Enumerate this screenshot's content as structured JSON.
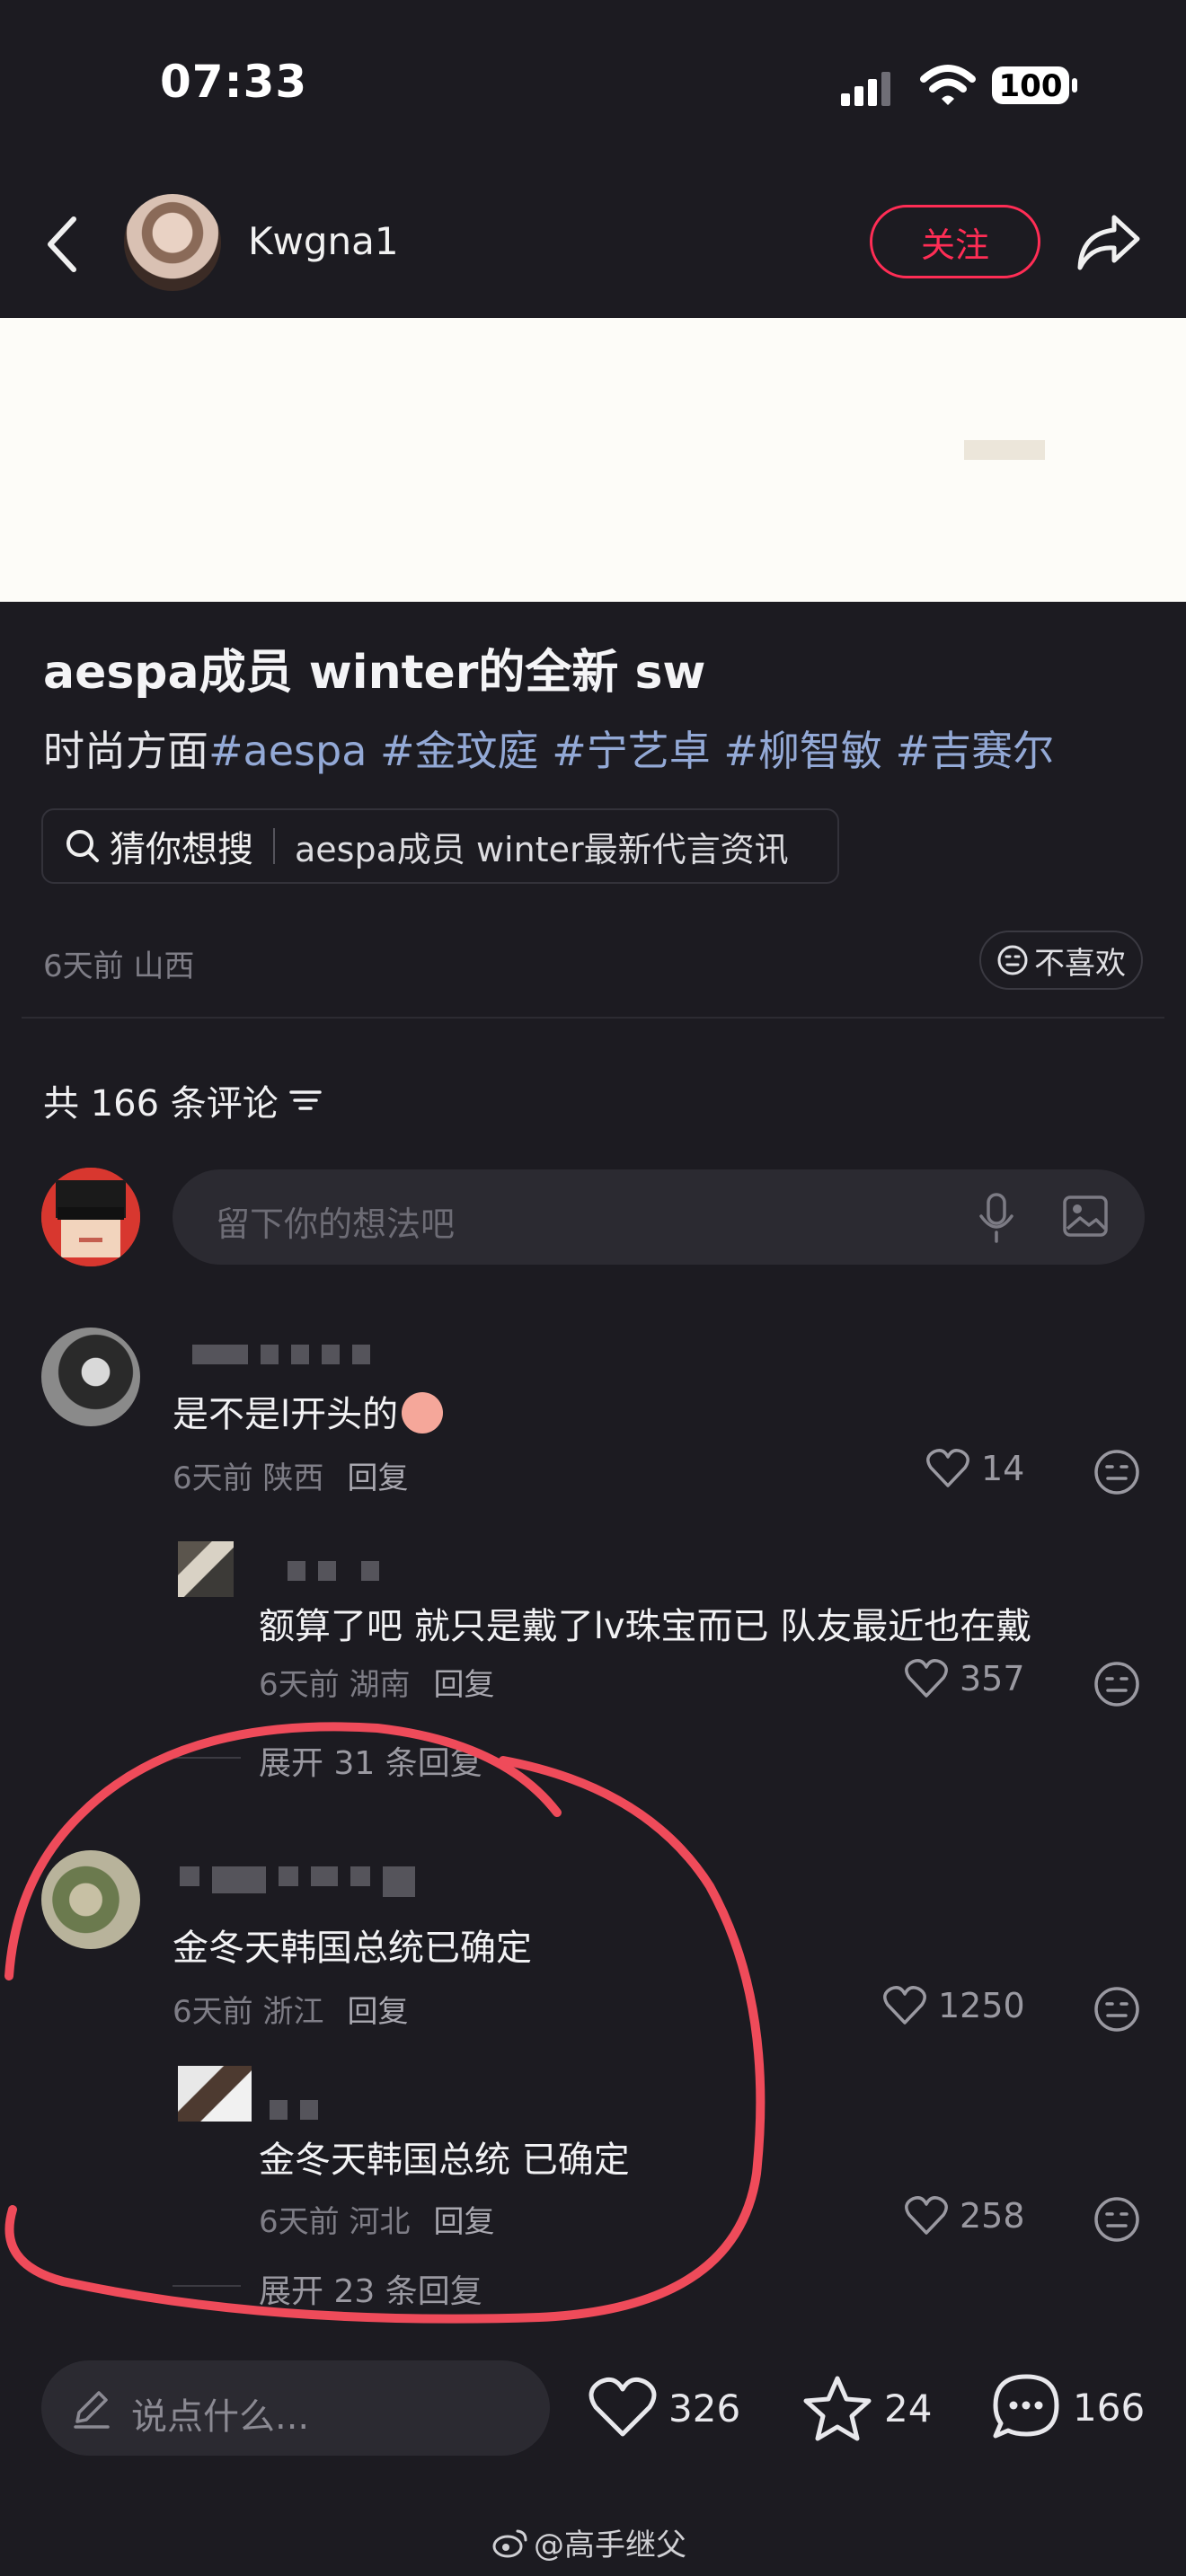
{
  "status_bar": {
    "time": "07:33",
    "battery": "100"
  },
  "header": {
    "author_name": "Kwgna1",
    "follow_label": "关注"
  },
  "post": {
    "title": "aespa成员 winter的全新 sw",
    "desc_prefix": "时尚方面",
    "tags": [
      "#aespa",
      "#金玟庭",
      "#宁艺卓",
      "#柳智敏",
      "#吉赛尔"
    ],
    "search_label": "猜你想搜",
    "search_suggestion": "aespa成员 winter最新代言资讯",
    "meta": "6天前 山西",
    "dislike_label": "不喜欢"
  },
  "comments": {
    "count_label": "共 166 条评论",
    "input_placeholder": "留下你的想法吧",
    "items": [
      {
        "text": "是不是l开头的",
        "meta": "6天前 陕西",
        "reply": "回复",
        "likes": "14"
      },
      {
        "text": "额算了吧 就只是戴了lv珠宝而已 队友最近也在戴",
        "meta": "6天前 湖南",
        "reply": "回复",
        "likes": "357"
      },
      {
        "expand": "展开 31 条回复"
      },
      {
        "text": "金冬天韩国总统已确定",
        "meta": "6天前 浙江",
        "reply": "回复",
        "likes": "1250"
      },
      {
        "text": "金冬天韩国总统  已确定",
        "meta": "6天前 河北",
        "reply": "回复",
        "likes": "258"
      },
      {
        "expand": "展开 23 条回复"
      }
    ]
  },
  "bottom_bar": {
    "input_placeholder": "说点什么...",
    "likes": "326",
    "favorites": "24",
    "comments": "166"
  },
  "watermark": "@高手继父",
  "colors": {
    "background": "#1c1b21",
    "accent": "#ff2d55",
    "tag": "#93a9d6",
    "annotation": "#ef4b5a"
  }
}
